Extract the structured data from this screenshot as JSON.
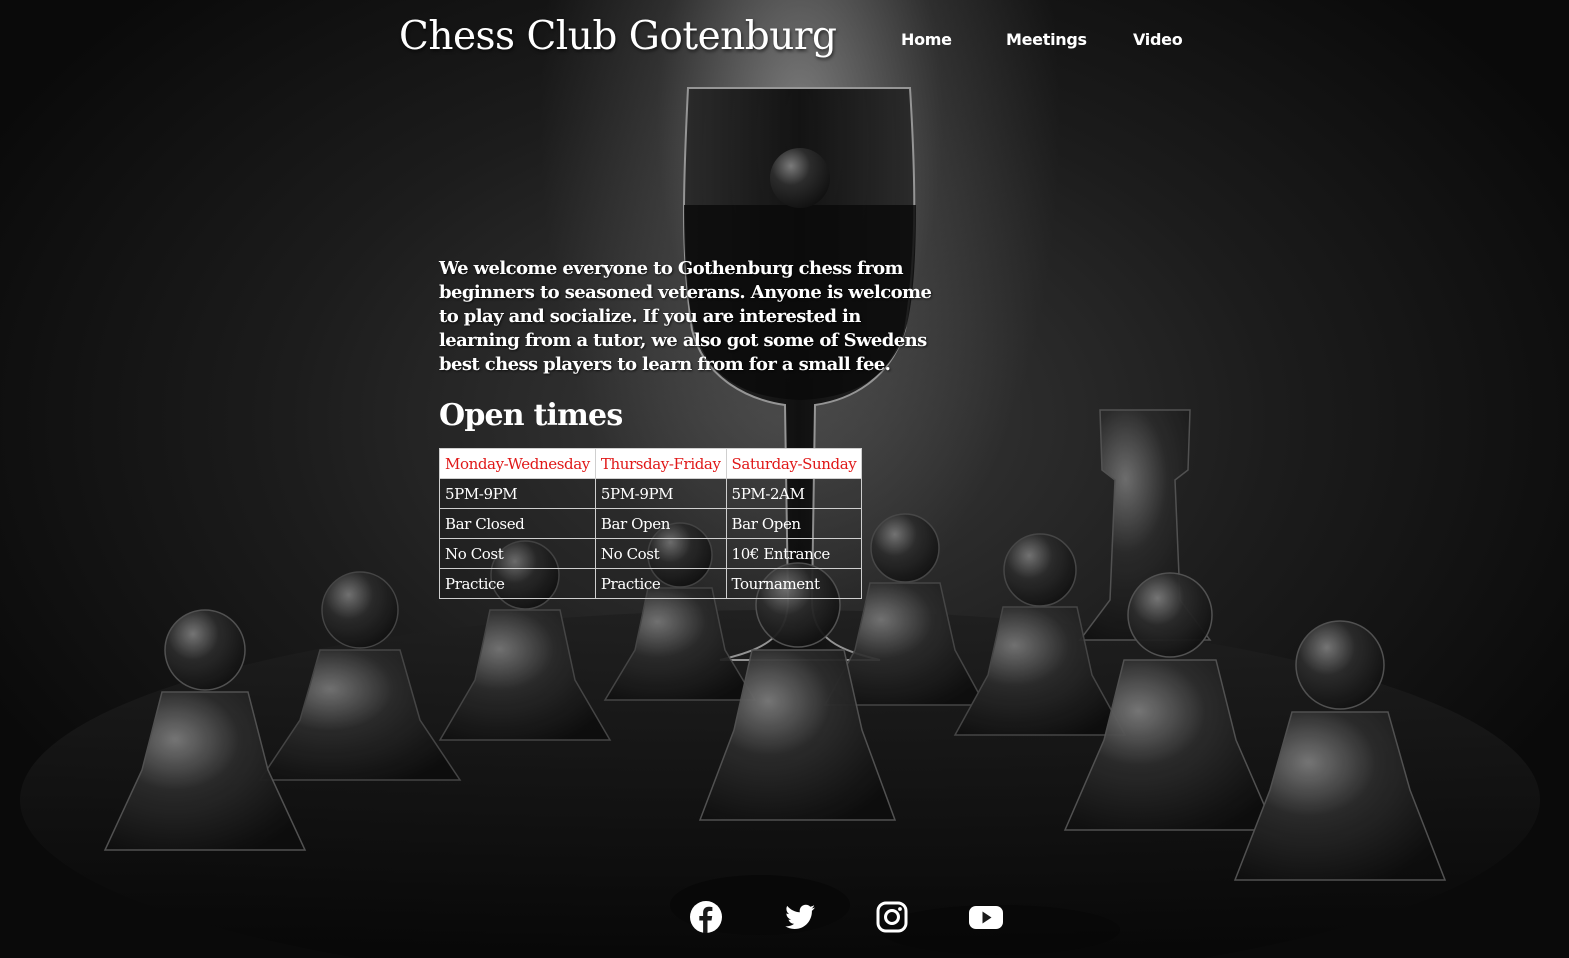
{
  "header": {
    "title": "Chess Club Gotenburg",
    "nav": [
      {
        "label": "Home"
      },
      {
        "label": "Meetings"
      },
      {
        "label": "Video"
      }
    ]
  },
  "main": {
    "intro": "We welcome everyone to Gothenburg chess from beginners to seasoned veterans. Anyone is welcome to play and socialize. If you are interested in learning from a tutor, we also got some of Swedens best chess players to learn from for a small fee.",
    "open_times": {
      "heading": "Open times",
      "headers": [
        "Monday-Wednesday",
        "Thursday-Friday",
        "Saturday-Sunday"
      ],
      "rows": [
        [
          "5PM-9PM",
          "5PM-9PM",
          "5PM-2AM"
        ],
        [
          "Bar Closed",
          "Bar Open",
          "Bar Open"
        ],
        [
          "No Cost",
          "No Cost",
          "10€ Entrance"
        ],
        [
          "Practice",
          "Practice",
          "Tournament"
        ]
      ]
    }
  },
  "footer": {
    "social": [
      {
        "icon": "facebook-icon"
      },
      {
        "icon": "twitter-icon"
      },
      {
        "icon": "instagram-icon"
      },
      {
        "icon": "youtube-icon"
      }
    ]
  },
  "colors": {
    "table_header_text": "#e01818",
    "table_header_bg": "#ffffff",
    "text": "#ffffff"
  }
}
